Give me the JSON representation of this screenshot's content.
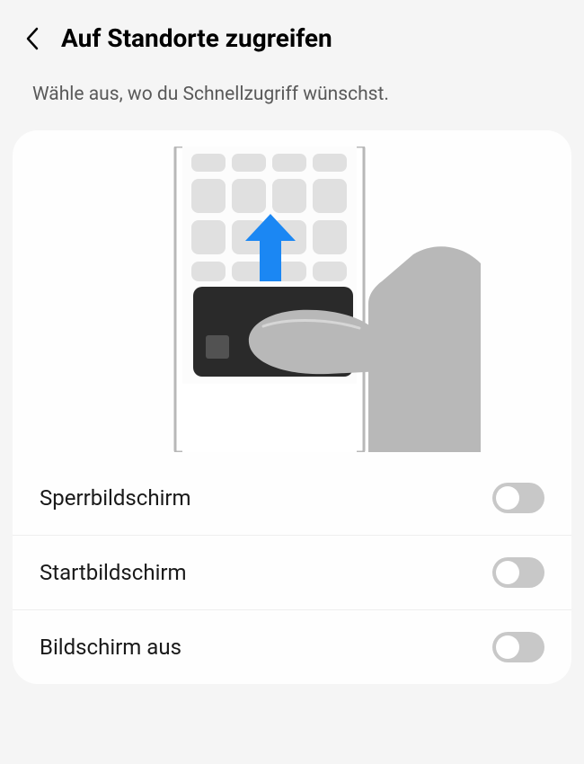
{
  "header": {
    "title": "Auf Standorte zugreifen"
  },
  "description": "Wähle aus, wo du Schnellzugriff wünschst.",
  "options": [
    {
      "label": "Sperrbildschirm",
      "enabled": false
    },
    {
      "label": "Startbildschirm",
      "enabled": false
    },
    {
      "label": "Bildschirm aus",
      "enabled": false
    }
  ]
}
